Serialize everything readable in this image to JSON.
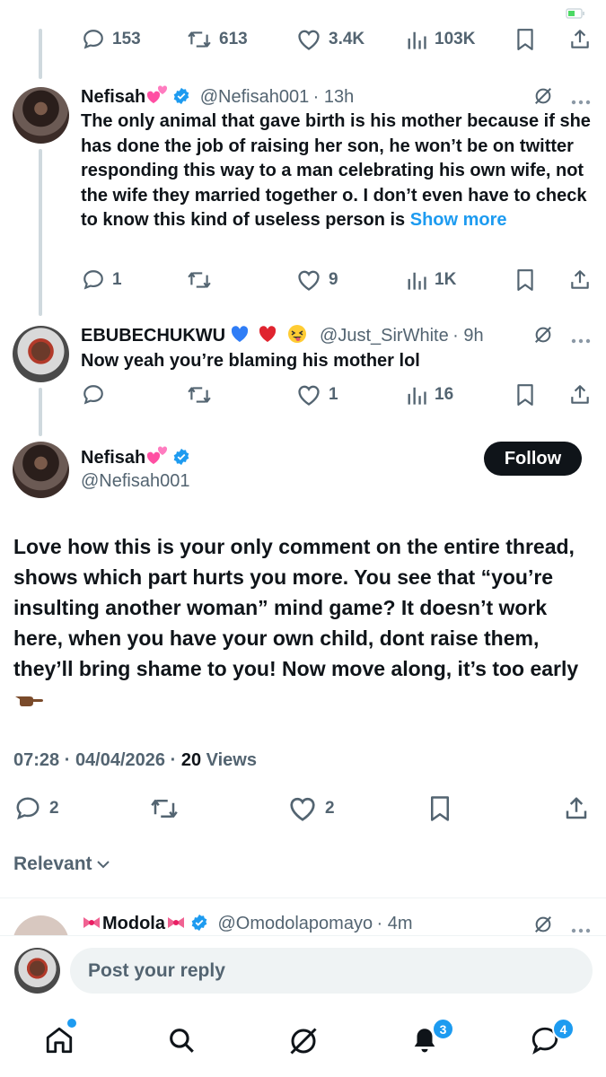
{
  "top_tweet_actions": {
    "replies": "153",
    "reposts": "613",
    "likes": "3.4K",
    "views": "103K"
  },
  "tweet1": {
    "name": "Nefisah",
    "handle": "@Nefisah001",
    "time": "· 13h",
    "text": "The only animal that gave birth is his mother because if she has done the job of raising her son, he won’t be on twitter responding this way to a man celebrating his own wife, not the wife they married together o. I don’t even have to check to know this kind of useless person is ",
    "show_more": "Show more",
    "replies": "1",
    "likes": "9",
    "views": "1K"
  },
  "tweet2": {
    "name": "EBUBECHUKWU",
    "handle": "@Just_SirWhite",
    "time": "· 9h",
    "text": "Now yeah you’re blaming his mother lol",
    "likes": "1",
    "views": "16"
  },
  "main_tweet": {
    "name": "Nefisah",
    "handle": "@Nefisah001",
    "follow_label": "Follow",
    "text": "Love how this is your only comment on the entire thread, shows which part hurts you more. You see that “you’re insulting another woman” mind game? It doesn’t work here, when you have your own child, dont raise them, they’ll bring shame to you! Now move along, it’s too early",
    "time": "07:28",
    "date": "04/04/2026",
    "views_count": "20",
    "views_label": "Views",
    "replies": "2",
    "likes": "2"
  },
  "sort": {
    "label": "Relevant"
  },
  "tweet3": {
    "name": "Modola",
    "handle": "@Omodolapomayo",
    "time": "· 4m"
  },
  "reply_bar": {
    "placeholder": "Post your reply"
  },
  "nav": {
    "notifications_badge": "3",
    "messages_badge": "4"
  },
  "colors": {
    "accent": "#1d9bf0",
    "text": "#0f1419",
    "muted": "#536471"
  }
}
